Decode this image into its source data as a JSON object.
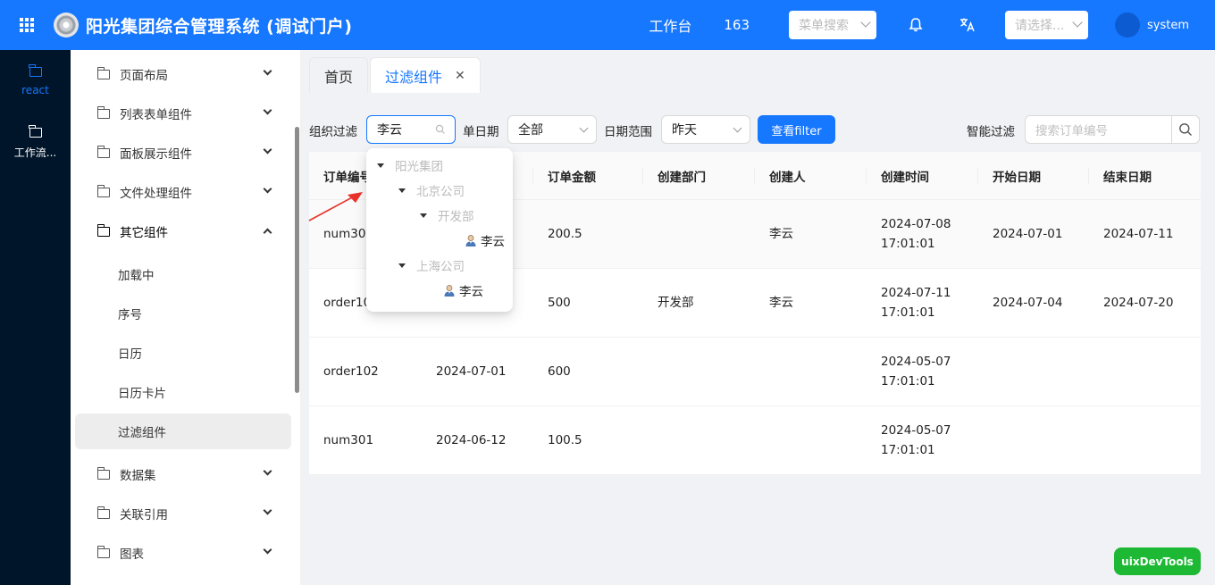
{
  "header": {
    "title": "阳光集团综合管理系统 (调试门户)",
    "workbench": "工作台",
    "count": "163",
    "menu_search_placeholder": "菜单搜索",
    "select_placeholder": "请选择...",
    "user": "system"
  },
  "rail": {
    "items": [
      {
        "label": "react"
      },
      {
        "label": "工作流..."
      }
    ]
  },
  "sidebar": {
    "menu": [
      "页面布局",
      "列表表单组件",
      "面板展示组件",
      "文件处理组件",
      "其它组件"
    ],
    "sub": [
      "加载中",
      "序号",
      "日历",
      "日历卡片",
      "过滤组件"
    ],
    "menu_after": [
      "数据集",
      "关联引用",
      "图表"
    ]
  },
  "tabs": {
    "home": "首页",
    "active": "过滤组件",
    "close": "✕"
  },
  "filters": {
    "org_label": "组织过滤",
    "org_value": "李云",
    "date_label": "单日期",
    "date_value": "全部",
    "range_label": "日期范围",
    "range_value": "昨天",
    "button": "查看filter",
    "smart_label": "智能过滤",
    "smart_placeholder": "搜索订单编号"
  },
  "table": {
    "headers": [
      "订单编号",
      "",
      "订单金额",
      "创建部门",
      "创建人",
      "创建时间",
      "开始日期",
      "结束日期"
    ],
    "rows": [
      [
        "num302",
        "",
        "200.5",
        "",
        "李云",
        "2024-07-08",
        "17:01:01",
        "2024-07-01",
        "2024-07-11"
      ],
      [
        "order10",
        "",
        "500",
        "开发部",
        "李云",
        "2024-07-11",
        "17:01:01",
        "2024-07-04",
        "2024-07-20"
      ],
      [
        "order102",
        "2024-07-01",
        "600",
        "",
        "",
        "2024-05-07",
        "17:01:01",
        "",
        ""
      ],
      [
        "num301",
        "2024-06-12",
        "100.5",
        "",
        "",
        "2024-05-07",
        "17:01:01",
        "",
        ""
      ]
    ]
  },
  "tree": {
    "root": "阳光集团",
    "beijing": "北京公司",
    "dev": "开发部",
    "user1": "李云",
    "shanghai": "上海公司",
    "user2": "李云"
  },
  "devtools": "uixDevTools",
  "colors": {
    "primary": "#1677ff",
    "rail": "#001529",
    "devtools": "#1db935",
    "arrow": "#e8322b"
  }
}
